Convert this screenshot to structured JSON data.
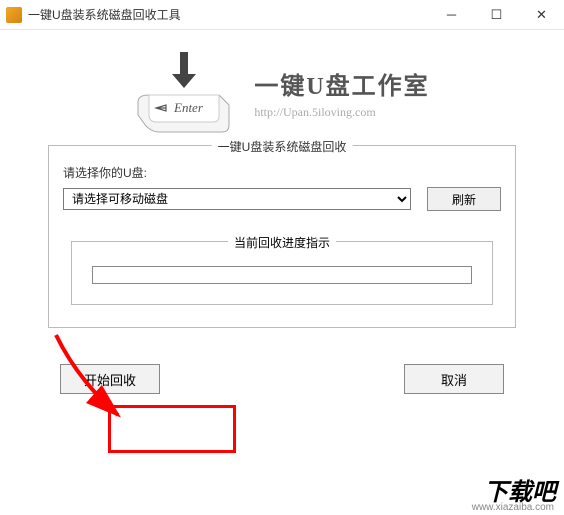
{
  "titlebar": {
    "title": "一键U盘装系统磁盘回收工具"
  },
  "brand": {
    "title": "一键U盘工作室",
    "url": "http://Upan.5iloving.com"
  },
  "fieldset_main": {
    "legend": "一键U盘装系统磁盘回收",
    "usb_label": "请选择你的U盘:",
    "select_placeholder": "请选择可移动磁盘",
    "refresh_label": "刷新"
  },
  "progress": {
    "legend": "当前回收进度指示"
  },
  "buttons": {
    "start_label": "开始回收",
    "cancel_label": "取消"
  },
  "watermark": {
    "text": "下载吧",
    "url": "www.xiazaiba.com"
  }
}
